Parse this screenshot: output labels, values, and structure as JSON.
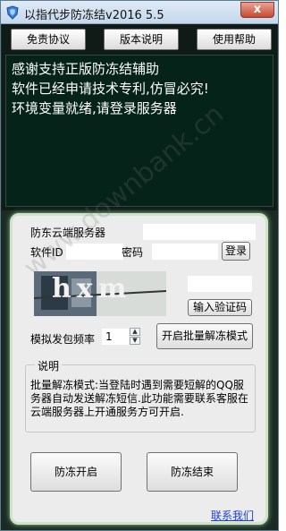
{
  "window": {
    "title": "以指代步防冻结v2016 5.5",
    "close_glyph": "x"
  },
  "toolbar": {
    "disclaimer_label": "免责协议",
    "version_label": "版本说明",
    "help_label": "使用帮助"
  },
  "messages": [
    "感谢支持正版防冻结辅助",
    "软件已经申请技术专利,仿冒必究!",
    "环境变量就绪,请登录服务器"
  ],
  "login": {
    "server_title": "防东云端服务器",
    "software_id_label": "软件ID",
    "software_id_value": "",
    "password_label": "密码",
    "password_value": "",
    "login_label": "登录",
    "captcha_text": "hxm",
    "captcha_input_value": "",
    "enter_captcha_label": "输入验证码"
  },
  "rate": {
    "label": "模拟发包频率",
    "value": "1",
    "up_glyph": "▲",
    "down_glyph": "▼",
    "batch_mode_label": "开启批量解冻模式"
  },
  "description": {
    "title": "说明",
    "text": "批量解冻模式:当登陆时遇到需要短解的QQ服务器自动发送解冻短信.此功能需要联系客服在云端服务器上开通服务方可开启."
  },
  "actions": {
    "start_label": "防冻开启",
    "stop_label": "防冻结束",
    "contact_label": "联系我们"
  },
  "watermark": "www.downbank.cn",
  "colors": {
    "message_text": "#ffffff",
    "message_bg": "#06231a",
    "panel_bg": "#ececec",
    "link": "#1a3fd6"
  }
}
